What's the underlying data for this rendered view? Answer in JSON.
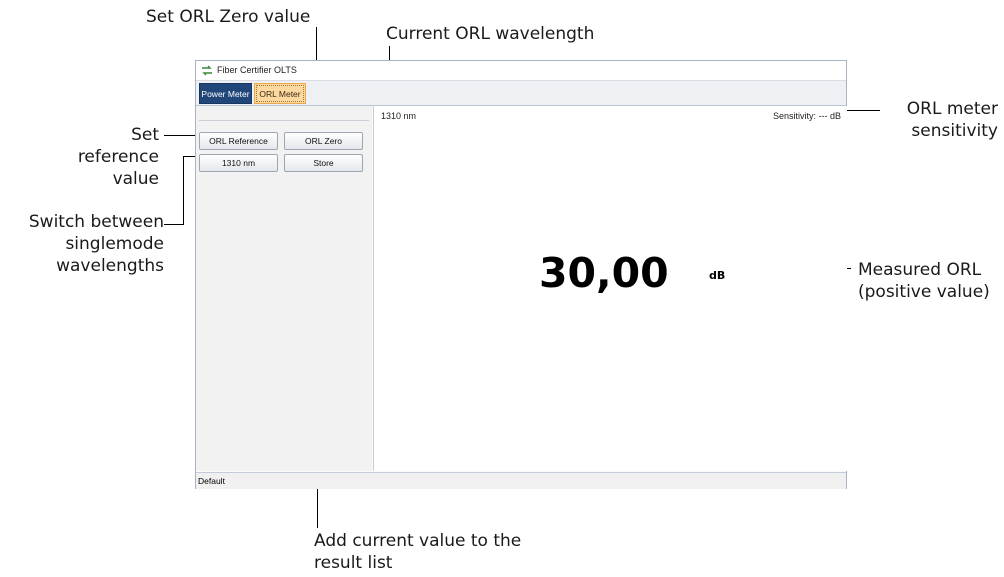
{
  "window": {
    "title": "Fiber Certifier OLTS",
    "tabs": [
      "Power Meter",
      "ORL Meter"
    ],
    "buttons": {
      "orl_reference": "ORL Reference",
      "orl_zero": "ORL Zero",
      "wavelength": "1310 nm",
      "store": "Store"
    },
    "current_wavelength": "1310 nm",
    "sensitivity": "Sensitivity:  --- dB",
    "measured_value": "30,00",
    "measured_unit": "dB",
    "status": "Default"
  },
  "callouts": {
    "set_orl_zero": "Set ORL Zero value",
    "current_wavelength": "Current ORL wavelength",
    "set_reference": "Set reference\nvalue",
    "switch_wavelengths": "Switch between\nsinglemode\nwavelengths",
    "sensitivity": "ORL meter\nsensitivity",
    "measured": "Measured ORL\n(positive value)",
    "add_to_results": "Add current value to the\nresult list"
  }
}
